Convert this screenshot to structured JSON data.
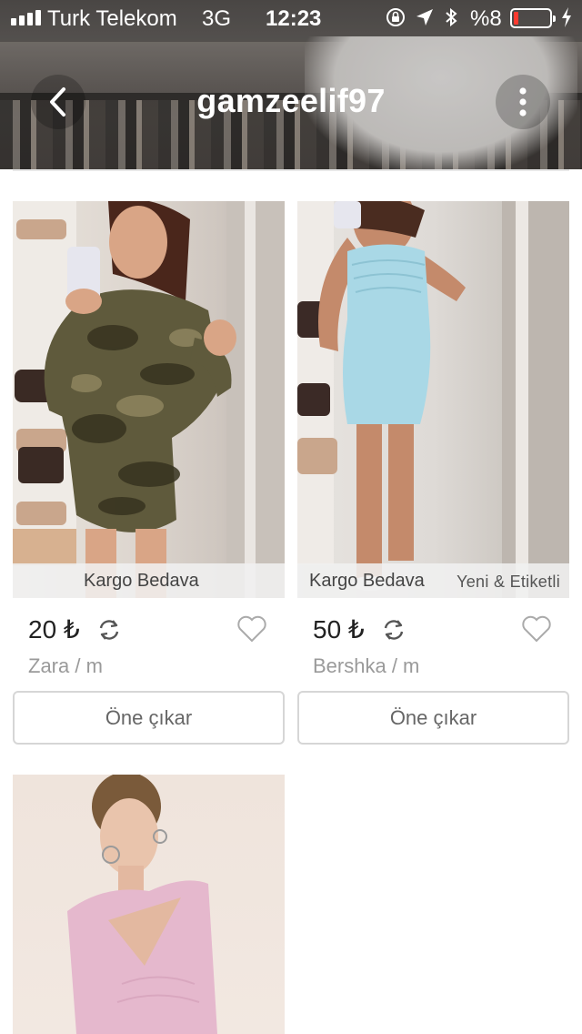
{
  "status_bar": {
    "carrier": "Turk Telekom",
    "network": "3G",
    "time": "12:23",
    "battery_percent": "%8"
  },
  "header": {
    "title": "gamzeelif97",
    "back_icon": "chevron-left-icon",
    "more_icon": "vertical-dots-icon"
  },
  "listings": [
    {
      "tags": [
        "Kargo Bedava"
      ],
      "price": "20 ₺",
      "meta": "Zara / m",
      "button": "Öne çıkar"
    },
    {
      "tags": [
        "Kargo Bedava",
        "Yeni & Etiketli"
      ],
      "price": "50 ₺",
      "meta": "Bershka / m",
      "button": "Öne çıkar"
    },
    {
      "tags": [],
      "price": "",
      "meta": "",
      "button": ""
    }
  ],
  "colors": {
    "accent_text": "#222222",
    "muted_text": "#9a9a9a",
    "border": "#d6d6d6",
    "battery_low": "#ff3b30"
  }
}
